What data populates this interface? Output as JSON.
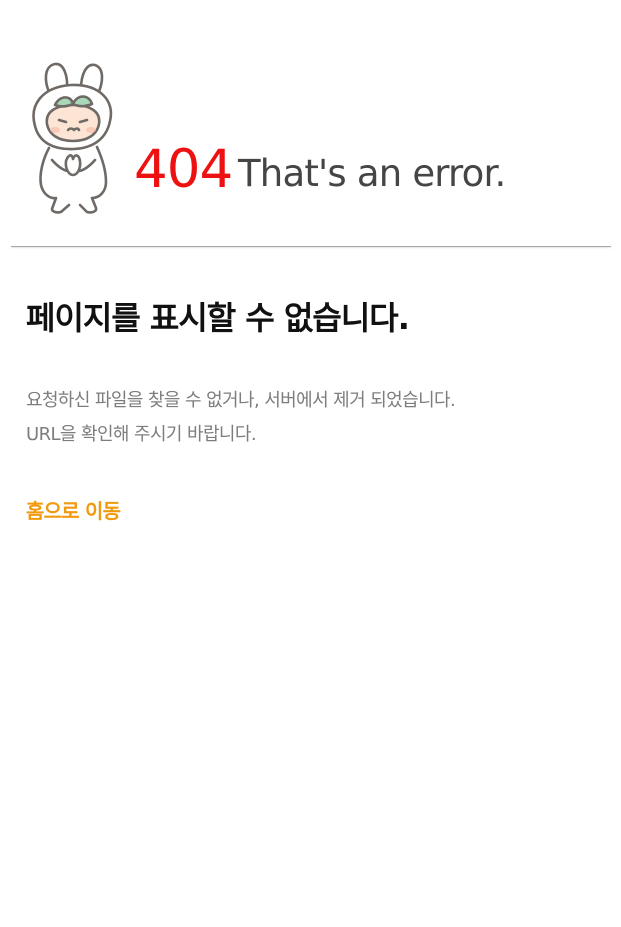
{
  "error": {
    "code": "404",
    "headline": "That's an error."
  },
  "main": {
    "title": "페이지를 표시할 수 없습니다.",
    "description": [
      "요청하신 파일을 찾을 수 없거나, 서버에서 제거 되었습니다.",
      "URL을 확인해 주시기 바랍니다."
    ],
    "home_link": "홈으로 이동"
  },
  "mascot": {
    "icon": "bunny-mascot-icon"
  },
  "colors": {
    "error_code": "#ee1111",
    "headline": "#454545",
    "title": "#111111",
    "description": "#7d7d7d",
    "link": "#f29a0f",
    "divider": "#a8a8a8",
    "mascot_outline": "#6f6a66",
    "mascot_leaf": "#a8d8b8",
    "mascot_face": "#fde5d6"
  }
}
